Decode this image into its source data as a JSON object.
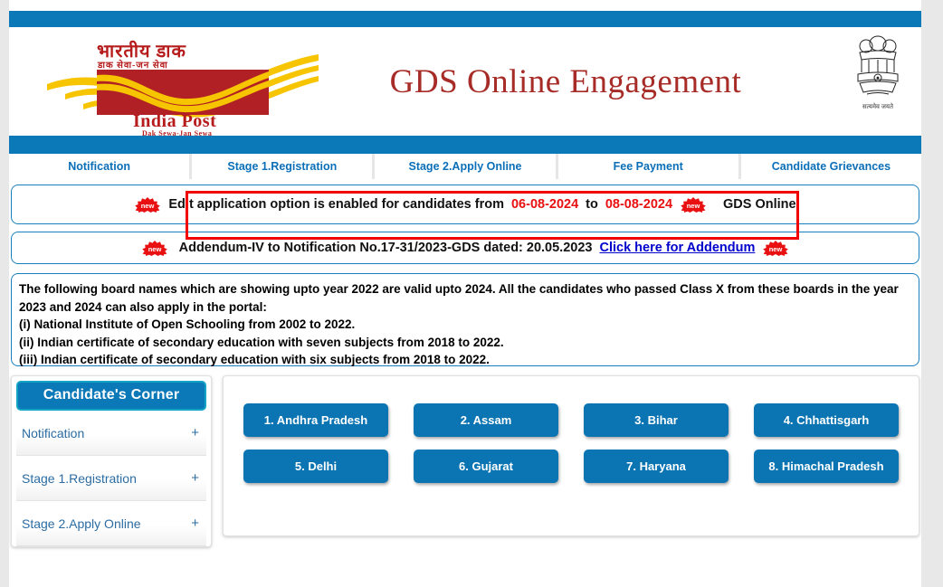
{
  "site": {
    "logo": {
      "hindi_line1": "भारतीय डाक",
      "hindi_line2": "डाक सेवा-जन सेवा",
      "name": "India Post",
      "tagline": "Dak Sewa-Jan Sewa"
    },
    "title": "GDS Online Engagement",
    "emblem_caption": "सत्यमेव जयते",
    "colors": {
      "header_blue": "#0b78b8",
      "title_red": "#a72b26",
      "link_blue": "#0000cc",
      "alert_red": "#e81010",
      "button_blue": "#0b74b2",
      "tab_text_blue": "#0b6fb8"
    }
  },
  "nav": {
    "tabs": [
      {
        "label": "Notification"
      },
      {
        "label": "Stage 1.Registration"
      },
      {
        "label": "Stage 2.Apply Online"
      },
      {
        "label": "Fee Payment"
      },
      {
        "label": "Candidate Grievances"
      }
    ]
  },
  "marquee": {
    "first": {
      "badge": "new",
      "text_before": "Edit application option is enabled for candidates from",
      "date_from": "06-08-2024",
      "text_middle": "to",
      "date_to": "08-08-2024",
      "badge2": "new",
      "trailing_text": "GDS Online"
    },
    "second": {
      "badge": "new",
      "text": "Addendum-IV to Notification No.17-31/2023-GDS dated: 20.05.2023",
      "link_label": "Click here for Addendum",
      "badge2": "new"
    }
  },
  "info": {
    "lines": [
      "The following board names which are showing upto year 2022 are valid upto 2024. All the candidates who passed Class X from these boards in the year 2023 and 2024 can also apply in the portal:",
      "(i) National Institute of Open Schooling from 2002 to 2022.",
      "(ii) Indian certificate of secondary education with seven subjects from 2018 to 2022.",
      "(iii) Indian certificate of secondary education with six subjects from 2018 to 2022."
    ]
  },
  "sidebar": {
    "header": "Candidate's Corner",
    "items": [
      {
        "label": "Notification",
        "expander": "+"
      },
      {
        "label": "Stage 1.Registration",
        "expander": "+"
      },
      {
        "label": "Stage 2.Apply Online",
        "expander": "+"
      }
    ]
  },
  "states": {
    "buttons": [
      {
        "label": "1. Andhra Pradesh"
      },
      {
        "label": "2. Assam"
      },
      {
        "label": "3. Bihar"
      },
      {
        "label": "4. Chhattisgarh"
      },
      {
        "label": "5. Delhi"
      },
      {
        "label": "6. Gujarat"
      },
      {
        "label": "7. Haryana"
      },
      {
        "label": "8. Himachal Pradesh"
      }
    ]
  }
}
